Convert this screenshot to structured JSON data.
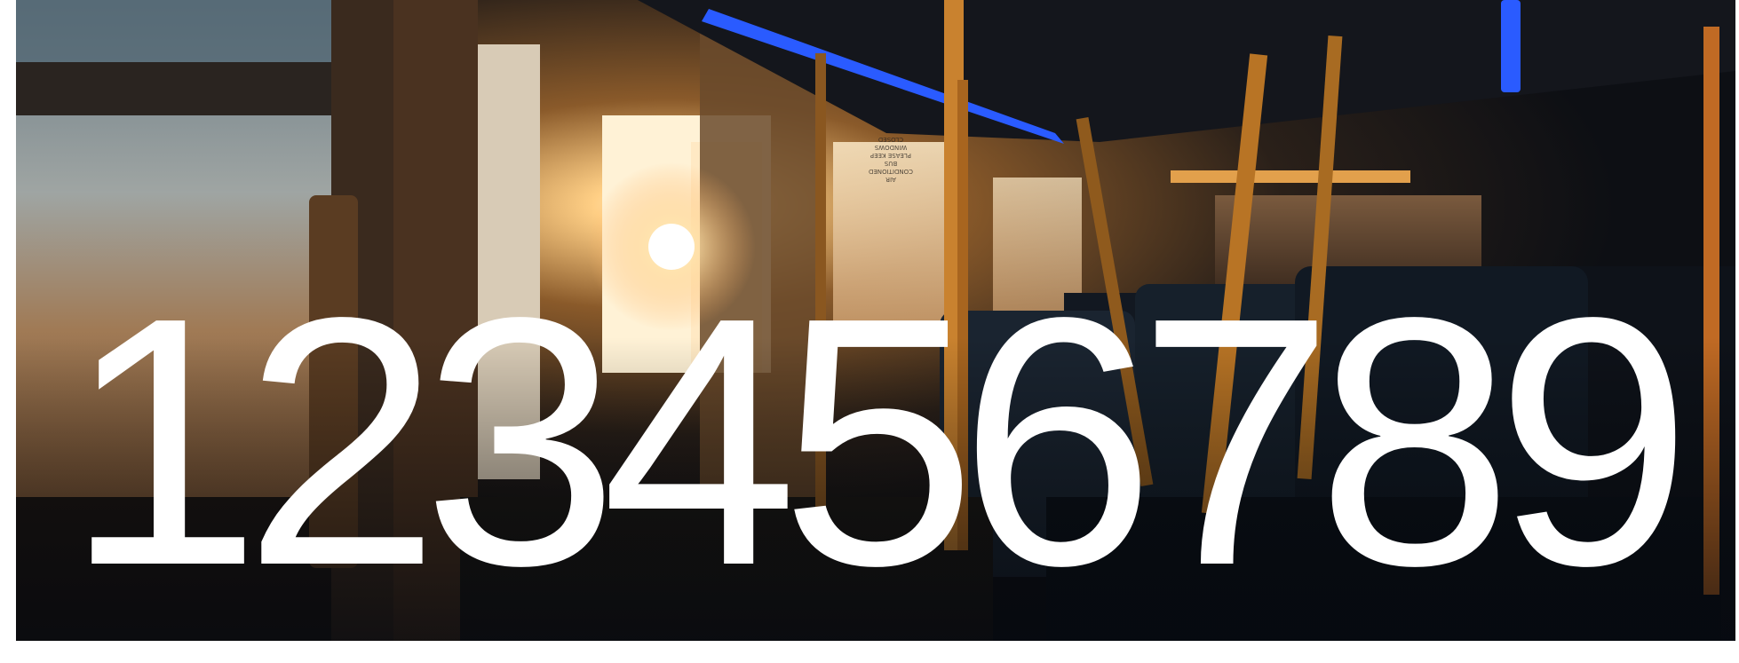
{
  "headline": {
    "text": "123456789"
  },
  "photo": {
    "subject": "sunlit-bus-interior",
    "sign_line_1": "AIR CONDITIONED BUS",
    "sign_line_2": "PLEASE KEEP WINDOWS CLOSED"
  },
  "colors": {
    "background": "#ffffff",
    "headline": "#ffffff",
    "accent_light": "#2a5bff",
    "sunlight": "#ffd9a0",
    "pole": "#c9822f"
  }
}
